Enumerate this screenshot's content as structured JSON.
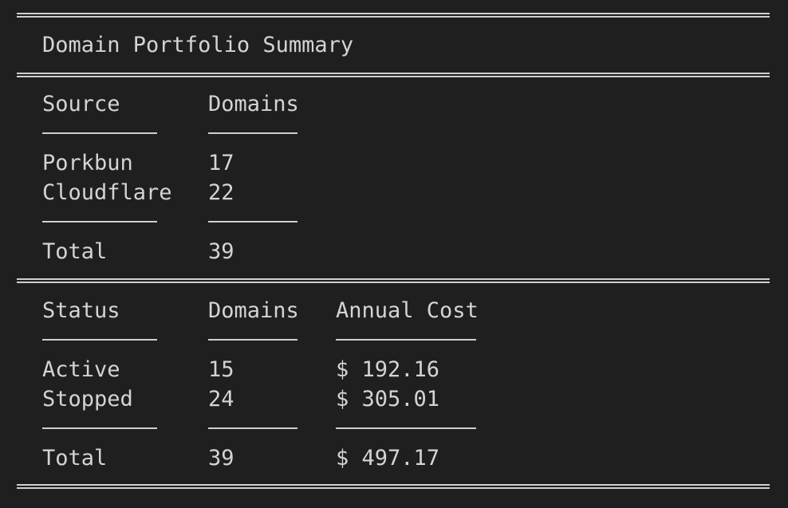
{
  "title": "Domain Portfolio Summary",
  "source_table": {
    "headers": [
      "Source",
      "Domains"
    ],
    "rows": [
      [
        "Porkbun",
        "17"
      ],
      [
        "Cloudflare",
        "22"
      ]
    ],
    "total": [
      "Total",
      "39"
    ]
  },
  "status_table": {
    "headers": [
      "Status",
      "Domains",
      "Annual Cost"
    ],
    "rows": [
      [
        "Active",
        "15",
        "$ 192.16"
      ],
      [
        "Stopped",
        "24",
        "$ 305.01"
      ]
    ],
    "total": [
      "Total",
      "39",
      "$ 497.17"
    ]
  }
}
